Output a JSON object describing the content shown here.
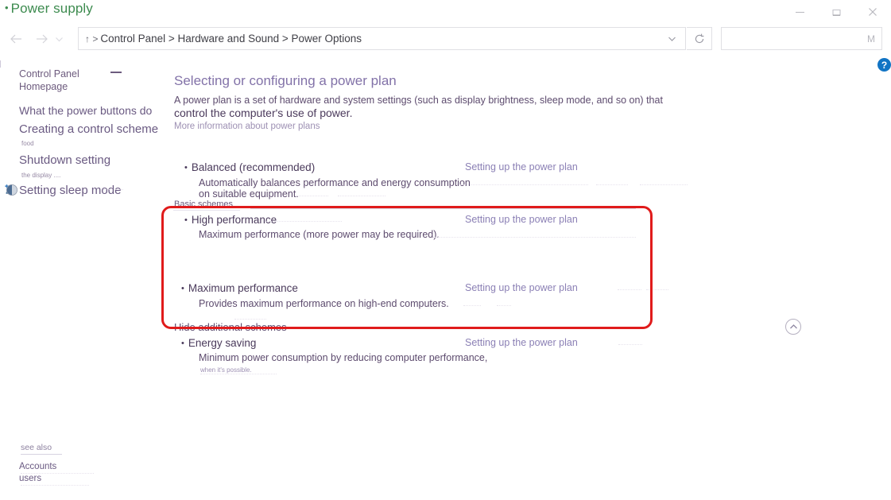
{
  "window": {
    "title": "Power supply",
    "controls": [
      {
        "name": "minimize",
        "glyph": "—"
      },
      {
        "name": "maximize",
        "glyph": "❐"
      },
      {
        "name": "close",
        "glyph": "✕"
      }
    ]
  },
  "navbar": {
    "back_icon": "←",
    "forward_icon": "→",
    "recent_icon": "⌄",
    "up_icon": "↑ >",
    "address_path": "Control Panel > Hardware and Sound > Power Options",
    "address_caret_icon": "⌄",
    "refresh_icon": "↻",
    "search_hint": "M",
    "search_placeholder": ""
  },
  "help": {
    "label": "?"
  },
  "sidebar": {
    "home": "Control Panel\nHomepage",
    "home_line1": "Control Panel",
    "home_line2": "Homepage",
    "links": [
      {
        "label": "What the power buttons do",
        "icon": ""
      },
      {
        "label": "Creating a control scheme",
        "icon": ""
      },
      {
        "label": "Shutdown setting",
        "icon": "shield-plus-icon"
      },
      {
        "label": "Setting sleep mode",
        "icon": "half-circle-icon"
      }
    ],
    "notes": [
      "food",
      "the display ...."
    ],
    "see_also": {
      "heading": "see also",
      "items": [
        "Accounts",
        "users"
      ]
    }
  },
  "main": {
    "page_title": "Selecting or configuring a power plan",
    "intro_line1": "A power plan is a set of hardware and system settings (such as display brightness, sleep mode, and so on) that",
    "intro_line2": "control the computer's use of power.",
    "more_info_link": "More information about power plans",
    "basic_schemes_label": "Basic schemes",
    "hide_additional_label": "Hide additional schemes",
    "collapse_icon": "⌃",
    "plans": [
      {
        "name": "Balanced (recommended)",
        "desc": "Automatically balances performance and energy consumption",
        "desc2": "on suitable equipment.",
        "link": "Setting up the power plan",
        "note": ""
      },
      {
        "name": "High performance",
        "desc": "Maximum performance (more power may be required).",
        "desc2": "",
        "link": "Setting up the power plan",
        "note": ""
      },
      {
        "name": "Maximum performance",
        "desc": "Provides maximum performance on high-end computers.",
        "desc2": "",
        "link": "Setting up the power plan",
        "note": ""
      },
      {
        "name": "Energy saving",
        "desc": "Minimum power consumption by reducing computer performance,",
        "desc2": "",
        "link": "Setting up the power plan",
        "note": "when it's possible."
      }
    ]
  },
  "colors": {
    "title_green": "#3d8b4f",
    "heading_purple": "#8272a8",
    "link_purple": "#8b80b5",
    "highlight_red": "#e01b1b",
    "help_blue": "#1174c4"
  }
}
